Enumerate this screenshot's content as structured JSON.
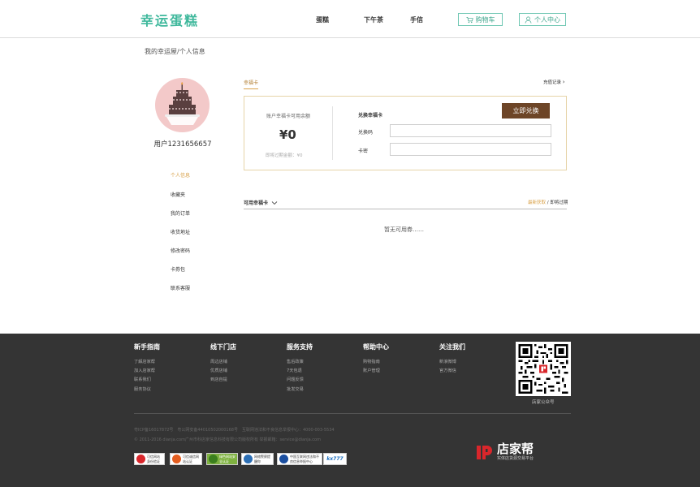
{
  "header": {
    "logo": "幸运蛋糕",
    "nav": [
      "蛋糕",
      "下午茶",
      "手信"
    ],
    "cart_label": "购物车",
    "user_center_label": "个人中心"
  },
  "breadcrumb": "我的幸运屋/个人信息",
  "profile": {
    "username": "用户1231656657"
  },
  "sidebar": {
    "items": [
      "个人信息",
      "收藏夹",
      "我的订单",
      "收货地址",
      "修改密码",
      "卡券包",
      "联系客服"
    ]
  },
  "lucky_card": {
    "tab_label": "幸福卡",
    "recharge_link": "充值记录",
    "balance_label": "账户幸福卡可用余额",
    "balance_value": "¥0",
    "expiring_text": "即将过期金额：¥0",
    "exchange_title": "兑换幸福卡",
    "exchange_button": "立即兑换",
    "code_label": "兑换码",
    "pwd_label": "卡密"
  },
  "available": {
    "title": "可用幸福卡",
    "filter_new": "最新获取",
    "filter_sep": " / ",
    "filter_expire": "即将过期",
    "empty_text": "暂无可用券……"
  },
  "footer": {
    "columns": [
      {
        "title": "新手指南",
        "links": [
          "了解店家帮",
          "加入店家帮",
          "联系我们",
          "服务协议"
        ]
      },
      {
        "title": "线下门店",
        "links": [
          "周边店铺",
          "优质店铺",
          "到店自提"
        ]
      },
      {
        "title": "服务支持",
        "links": [
          "售后政策",
          "7天包退",
          "问题反馈",
          "批发交易"
        ]
      },
      {
        "title": "帮助中心",
        "links": [
          "购物指南",
          "账户管理"
        ]
      },
      {
        "title": "关注我们",
        "links": [
          "新浪微博",
          "官方微信"
        ]
      }
    ],
    "qr_caption": "店家公众号",
    "license_line": "粤ICP备16017872号　粤公网安备44010502000168号　互联网违法和不良信息举报中心：4000-003-5534",
    "copyright_line": "© 2011-2016 dianja.com广州市科店家信息科技有限公司版权所有 举报邮箱：service@dianja.com",
    "badges": [
      "可信网站身份验证",
      "可信诚信网站认证",
      "绿色网站安全认证",
      "网络警察提醒你",
      "中国互联网违法和不良信息举报中心",
      "kx777"
    ],
    "brand_name": "店家帮",
    "brand_sub": "实体店货源交易平台"
  },
  "colors": {
    "brand_green": "#3fb89c",
    "accent_gold": "#d9a24a",
    "button_brown": "#6d4527",
    "footer_bg": "#343434"
  }
}
